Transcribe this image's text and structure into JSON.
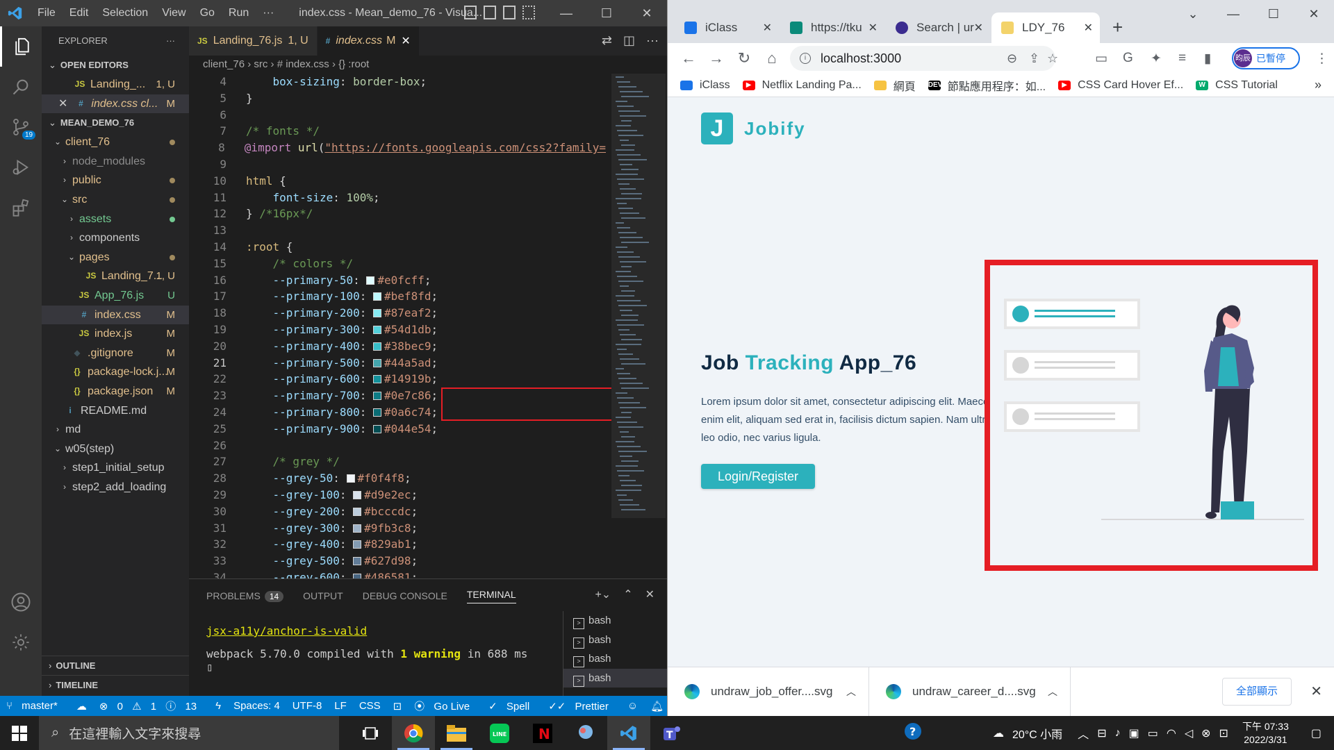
{
  "vscode": {
    "menu": [
      "File",
      "Edit",
      "Selection",
      "View",
      "Go",
      "Run",
      "···"
    ],
    "window_title": "index.css - Mean_demo_76 - Visua...",
    "activity_badge": "19",
    "explorer_title": "EXPLORER",
    "open_editors_label": "OPEN EDITORS",
    "open_editors": [
      {
        "icon": "JS",
        "name": "Landing_...",
        "status": "1, U"
      },
      {
        "icon": "#",
        "name": "index.css cl...",
        "status": "M"
      }
    ],
    "project_label": "MEAN_DEMO_76",
    "tree": [
      {
        "indent": 1,
        "chev": "v",
        "icon": "",
        "name": "client_76",
        "status": "dot",
        "color": "mod"
      },
      {
        "indent": 2,
        "chev": ">",
        "icon": "",
        "name": "node_modules",
        "status": "",
        "color": "dim"
      },
      {
        "indent": 2,
        "chev": ">",
        "icon": "",
        "name": "public",
        "status": "dot",
        "color": "mod"
      },
      {
        "indent": 2,
        "chev": "v",
        "icon": "",
        "name": "src",
        "status": "dot",
        "color": "mod"
      },
      {
        "indent": 3,
        "chev": ">",
        "icon": "",
        "name": "assets",
        "status": "dot",
        "color": "untr"
      },
      {
        "indent": 3,
        "chev": ">",
        "icon": "",
        "name": "components",
        "status": "",
        "color": "plain"
      },
      {
        "indent": 3,
        "chev": "v",
        "icon": "",
        "name": "pages",
        "status": "dot",
        "color": "mod"
      },
      {
        "indent": 4,
        "chev": "",
        "icon": "JS",
        "name": "Landing_7...",
        "status": "1, U",
        "color": "mod"
      },
      {
        "indent": 3,
        "chev": "",
        "icon": "JS",
        "name": "App_76.js",
        "status": "U",
        "color": "untr"
      },
      {
        "indent": 3,
        "chev": "",
        "icon": "#",
        "name": "index.css",
        "status": "M",
        "color": "mod",
        "selected": true
      },
      {
        "indent": 3,
        "chev": "",
        "icon": "JS",
        "name": "index.js",
        "status": "M",
        "color": "mod"
      },
      {
        "indent": 2,
        "chev": "",
        "icon": "◆",
        "name": ".gitignore",
        "status": "M",
        "color": "mod"
      },
      {
        "indent": 2,
        "chev": "",
        "icon": "{}",
        "name": "package-lock.j...",
        "status": "M",
        "color": "mod"
      },
      {
        "indent": 2,
        "chev": "",
        "icon": "{}",
        "name": "package.json",
        "status": "M",
        "color": "mod"
      },
      {
        "indent": 1,
        "chev": "",
        "icon": "i",
        "name": "README.md",
        "status": "",
        "color": "plain"
      },
      {
        "indent": 1,
        "chev": ">",
        "icon": "",
        "name": "md",
        "status": "",
        "color": "plain"
      },
      {
        "indent": 1,
        "chev": "v",
        "icon": "",
        "name": "w05(step)",
        "status": "",
        "color": "plain"
      },
      {
        "indent": 2,
        "chev": ">",
        "icon": "",
        "name": "step1_initial_setup",
        "status": "",
        "color": "plain"
      },
      {
        "indent": 2,
        "chev": ">",
        "icon": "",
        "name": "step2_add_loading",
        "status": "",
        "color": "plain"
      }
    ],
    "outline_label": "OUTLINE",
    "timeline_label": "TIMELINE",
    "tabs": [
      {
        "icon": "JS",
        "name": "Landing_76.js",
        "status": "1, U"
      },
      {
        "icon": "#",
        "name": "index.css",
        "status": "M"
      }
    ],
    "breadcrumb": [
      "client_76",
      "src",
      "# index.css",
      "{} :root"
    ],
    "code_lines": [
      {
        "n": "4",
        "t": "    box-sizing: border-box;"
      },
      {
        "n": "5",
        "t": "}"
      },
      {
        "n": "6",
        "t": ""
      },
      {
        "n": "7",
        "t": "/* fonts */"
      },
      {
        "n": "8",
        "t": "@import url(\"https://fonts.googleapis.com/css2?family="
      },
      {
        "n": "9",
        "t": ""
      },
      {
        "n": "10",
        "t": "html {"
      },
      {
        "n": "11",
        "t": "    font-size: 100%;"
      },
      {
        "n": "12",
        "t": "} /*16px*/"
      },
      {
        "n": "13",
        "t": ""
      },
      {
        "n": "14",
        "t": ":root {"
      },
      {
        "n": "15",
        "t": "    /* colors */"
      },
      {
        "n": "16",
        "t": "    --primary-50: #e0fcff;",
        "sw": "#e0fcff"
      },
      {
        "n": "17",
        "t": "    --primary-100: #bef8fd;",
        "sw": "#bef8fd"
      },
      {
        "n": "18",
        "t": "    --primary-200: #87eaf2;",
        "sw": "#87eaf2"
      },
      {
        "n": "19",
        "t": "    --primary-300: #54d1db;",
        "sw": "#54d1db"
      },
      {
        "n": "20",
        "t": "    --primary-400: #38bec9;",
        "sw": "#38bec9"
      },
      {
        "n": "21",
        "t": "    --primary-500: #44a5ad;",
        "sw": "#44a5ad"
      },
      {
        "n": "22",
        "t": "    --primary-600: #14919b;",
        "sw": "#14919b"
      },
      {
        "n": "23",
        "t": "    --primary-700: #0e7c86;",
        "sw": "#0e7c86"
      },
      {
        "n": "24",
        "t": "    --primary-800: #0a6c74;",
        "sw": "#0a6c74"
      },
      {
        "n": "25",
        "t": "    --primary-900: #044e54;",
        "sw": "#044e54"
      },
      {
        "n": "26",
        "t": ""
      },
      {
        "n": "27",
        "t": "    /* grey */"
      },
      {
        "n": "28",
        "t": "    --grey-50: #f0f4f8;",
        "sw": "#f0f4f8"
      },
      {
        "n": "29",
        "t": "    --grey-100: #d9e2ec;",
        "sw": "#d9e2ec"
      },
      {
        "n": "30",
        "t": "    --grey-200: #bcccdc;",
        "sw": "#bcccdc"
      },
      {
        "n": "31",
        "t": "    --grey-300: #9fb3c8;",
        "sw": "#9fb3c8"
      },
      {
        "n": "32",
        "t": "    --grey-400: #829ab1;",
        "sw": "#829ab1"
      },
      {
        "n": "33",
        "t": "    --grey-500: #627d98;",
        "sw": "#627d98"
      },
      {
        "n": "34",
        "t": "    --grey-600: #486581;",
        "sw": "#486581"
      }
    ],
    "current_line": "21",
    "panel": {
      "tabs": [
        "PROBLEMS",
        "OUTPUT",
        "DEBUG CONSOLE",
        "TERMINAL"
      ],
      "problems_count": "14",
      "active_tab": "TERMINAL",
      "term_line1": "jsx-a11y/anchor-is-valid",
      "term_line2_a": "webpack 5.70.0 compiled with ",
      "term_line2_b": "1 warning",
      "term_line2_c": " in 688 ms",
      "cursor": "▯",
      "shells": [
        "bash",
        "bash",
        "bash",
        "bash"
      ]
    },
    "status": {
      "branch": "master*",
      "errors": "0",
      "warnings": "1",
      "info": "13",
      "spaces": "Spaces: 4",
      "encoding": "UTF-8",
      "eol": "LF",
      "language": "CSS",
      "golive": "Go Live",
      "spell": "Spell",
      "prettier": "Prettier"
    }
  },
  "chrome": {
    "tabs": [
      {
        "title": "iClass",
        "fav": "#1a73e8"
      },
      {
        "title": "https://tku",
        "fav": "#0b8a7a"
      },
      {
        "title": "Search | ur",
        "fav": "#3b2c8f"
      },
      {
        "title": "LDY_76",
        "fav": "#f3d36b"
      }
    ],
    "url": "localhost:3000",
    "profile": "已暫停",
    "profile_avatar": "昀辰",
    "bookmarks": [
      {
        "title": "iClass",
        "color": "#1a73e8",
        "glyph": ""
      },
      {
        "title": "Netflix Landing Pa...",
        "color": "#ff0000",
        "glyph": "▶"
      },
      {
        "title": "網頁",
        "color": "#f6c342",
        "glyph": ""
      },
      {
        "title": "節點應用程序：如...",
        "color": "#000000",
        "glyph": "DEV"
      },
      {
        "title": "CSS Card Hover Ef...",
        "color": "#ff0000",
        "glyph": "▶"
      },
      {
        "title": "CSS Tutorial",
        "color": "#04aa6d",
        "glyph": "W"
      }
    ],
    "page": {
      "logo_letter": "J",
      "logo_word": "Jobify",
      "title_a": "Job ",
      "title_b": "Tracking",
      "title_c": " App_76",
      "lorem": "Lorem ipsum dolor sit amet, consectetur adipiscing elit. Maecena\nenim elit, aliquam sed erat in, facilisis dictum sapien. Nam ultrices\nleo odio, nec varius ligula.",
      "cta": "Login/Register",
      "brand_color": "#2cb1bc"
    },
    "downloads": [
      {
        "name": "undraw_job_offer....svg"
      },
      {
        "name": "undraw_career_d....svg"
      }
    ],
    "show_all": "全部顯示"
  },
  "taskbar": {
    "search_placeholder": "在這裡輸入文字來搜尋",
    "weather": "20°C 小雨",
    "time": "下午 07:33",
    "date": "2022/3/31"
  }
}
